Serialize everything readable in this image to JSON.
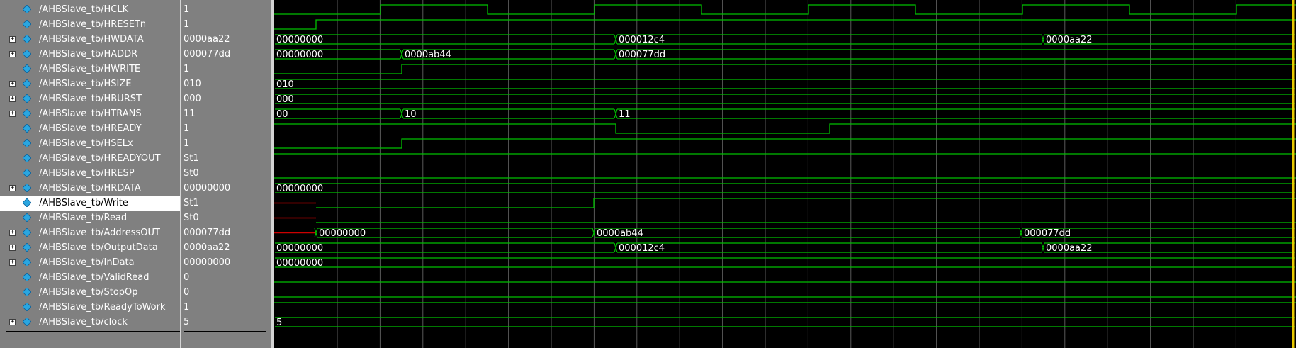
{
  "signals": [
    {
      "name": "/AHBSlave_tb/HCLK",
      "value": "1",
      "expandable": false,
      "kind": "clock",
      "selected": false
    },
    {
      "name": "/AHBSlave_tb/HRESETn",
      "value": "1",
      "expandable": false,
      "kind": "bit",
      "edges": [
        [
          0,
          0
        ],
        [
          60,
          0
        ],
        [
          60,
          1
        ]
      ],
      "selected": false
    },
    {
      "name": "/AHBSlave_tb/HWDATA",
      "value": "0000aa22",
      "expandable": true,
      "kind": "bus",
      "buses": [
        [
          "00000000",
          0
        ],
        [
          "000012c4",
          483
        ],
        [
          "0000aa22",
          1086
        ]
      ],
      "selected": false
    },
    {
      "name": "/AHBSlave_tb/HADDR",
      "value": "000077dd",
      "expandable": true,
      "kind": "bus",
      "buses": [
        [
          "00000000",
          0
        ],
        [
          "0000ab44",
          181
        ],
        [
          "000077dd",
          483
        ]
      ],
      "selected": false
    },
    {
      "name": "/AHBSlave_tb/HWRITE",
      "value": "1",
      "expandable": false,
      "kind": "bit",
      "edges": [
        [
          0,
          0
        ],
        [
          181,
          0
        ],
        [
          181,
          1
        ]
      ],
      "selected": false
    },
    {
      "name": "/AHBSlave_tb/HSIZE",
      "value": "010",
      "expandable": true,
      "kind": "bus",
      "buses": [
        [
          "010",
          0
        ]
      ],
      "selected": false
    },
    {
      "name": "/AHBSlave_tb/HBURST",
      "value": "000",
      "expandable": true,
      "kind": "bus",
      "buses": [
        [
          "000",
          0
        ]
      ],
      "selected": false
    },
    {
      "name": "/AHBSlave_tb/HTRANS",
      "value": "11",
      "expandable": true,
      "kind": "bus",
      "buses": [
        [
          "00",
          0
        ],
        [
          "10",
          181
        ],
        [
          "11",
          483
        ]
      ],
      "selected": false
    },
    {
      "name": "/AHBSlave_tb/HREADY",
      "value": "1",
      "expandable": false,
      "kind": "bit",
      "edges": [
        [
          0,
          1
        ],
        [
          483,
          1
        ],
        [
          483,
          0
        ],
        [
          785,
          0
        ],
        [
          785,
          1
        ]
      ],
      "selected": false
    },
    {
      "name": "/AHBSlave_tb/HSELx",
      "value": "1",
      "expandable": false,
      "kind": "bit",
      "edges": [
        [
          0,
          0
        ],
        [
          181,
          0
        ],
        [
          181,
          1
        ]
      ],
      "selected": false
    },
    {
      "name": "/AHBSlave_tb/HREADYOUT",
      "value": "St1",
      "expandable": false,
      "kind": "bit",
      "edges": [
        [
          0,
          1
        ]
      ],
      "selected": false
    },
    {
      "name": "/AHBSlave_tb/HRESP",
      "value": "St0",
      "expandable": false,
      "kind": "bit",
      "edges": [
        [
          0,
          0
        ]
      ],
      "selected": false
    },
    {
      "name": "/AHBSlave_tb/HRDATA",
      "value": "00000000",
      "expandable": true,
      "kind": "bus",
      "buses": [
        [
          "00000000",
          0
        ]
      ],
      "selected": false
    },
    {
      "name": "/AHBSlave_tb/Write",
      "value": "St1",
      "expandable": false,
      "kind": "bit",
      "red": [
        0,
        60
      ],
      "edges": [
        [
          60,
          0
        ],
        [
          452,
          0
        ],
        [
          452,
          1
        ]
      ],
      "selected": true
    },
    {
      "name": "/AHBSlave_tb/Read",
      "value": "St0",
      "expandable": false,
      "kind": "bit",
      "red": [
        0,
        60
      ],
      "edges": [
        [
          60,
          0
        ]
      ],
      "selected": false
    },
    {
      "name": "/AHBSlave_tb/AddressOUT",
      "value": "000077dd",
      "expandable": true,
      "kind": "bus",
      "red": [
        0,
        60
      ],
      "buses": [
        [
          "00000000",
          60
        ],
        [
          "0000ab44",
          452
        ],
        [
          "000077dd",
          1055
        ]
      ],
      "selected": false
    },
    {
      "name": "/AHBSlave_tb/OutputData",
      "value": "0000aa22",
      "expandable": true,
      "kind": "bus",
      "buses": [
        [
          "00000000",
          0
        ],
        [
          "000012c4",
          483
        ],
        [
          "0000aa22",
          1086
        ]
      ],
      "selected": false
    },
    {
      "name": "/AHBSlave_tb/InData",
      "value": "00000000",
      "expandable": true,
      "kind": "bus",
      "buses": [
        [
          "00000000",
          0
        ]
      ],
      "selected": false
    },
    {
      "name": "/AHBSlave_tb/ValidRead",
      "value": "0",
      "expandable": false,
      "kind": "bit",
      "edges": [
        [
          0,
          0
        ]
      ],
      "selected": false
    },
    {
      "name": "/AHBSlave_tb/StopOp",
      "value": "0",
      "expandable": false,
      "kind": "bit",
      "edges": [
        [
          0,
          0
        ]
      ],
      "selected": false
    },
    {
      "name": "/AHBSlave_tb/ReadyToWork",
      "value": "1",
      "expandable": false,
      "kind": "bit",
      "edges": [
        [
          0,
          1
        ]
      ],
      "selected": false
    },
    {
      "name": "/AHBSlave_tb/clock",
      "value": "5",
      "expandable": true,
      "kind": "bus",
      "buses": [
        [
          "5",
          0
        ]
      ],
      "selected": false
    }
  ],
  "clock": {
    "half_period": 151,
    "first_rise": 151
  },
  "colors": {
    "wave": "#00c000",
    "unknown": "#cc0000",
    "grid": "#5a5a5a",
    "cursor": "#e8c800",
    "diamond": "#2aa6e0"
  }
}
